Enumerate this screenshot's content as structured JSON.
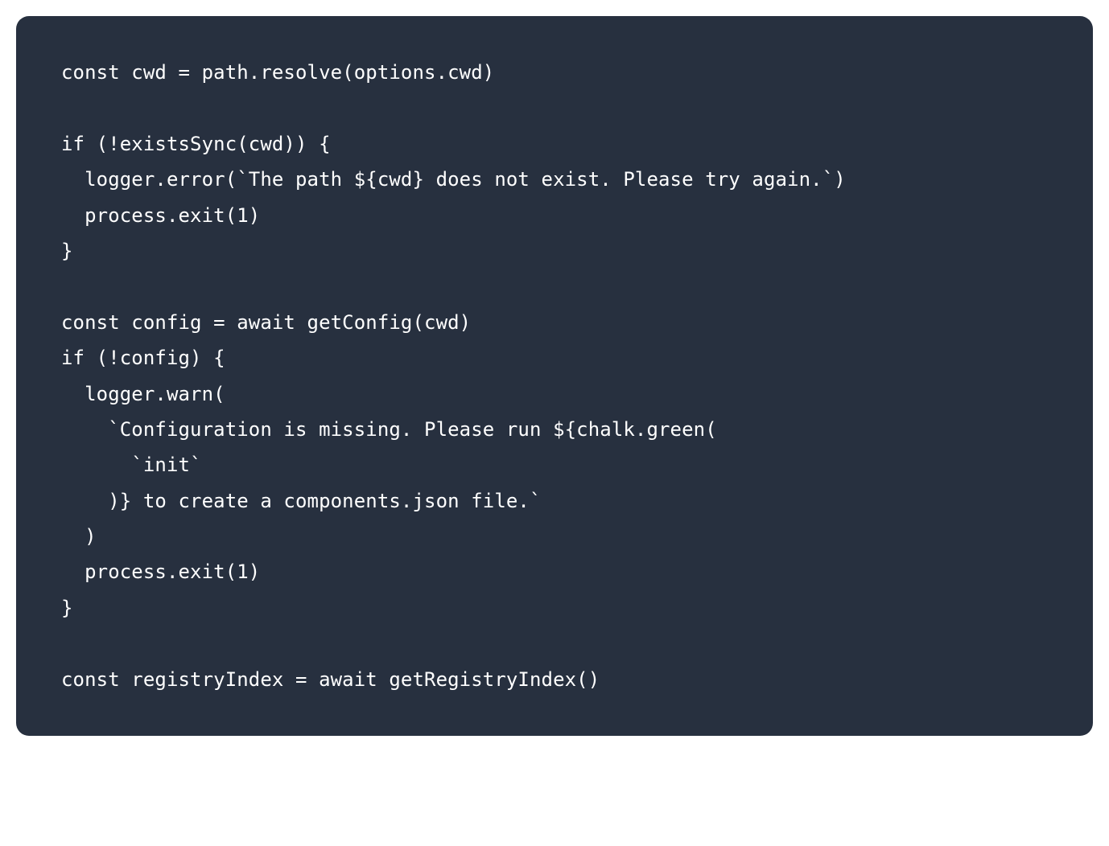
{
  "code": {
    "lines": [
      "const cwd = path.resolve(options.cwd)",
      "",
      "if (!existsSync(cwd)) {",
      "  logger.error(`The path ${cwd} does not exist. Please try again.`)",
      "  process.exit(1)",
      "}",
      "",
      "const config = await getConfig(cwd)",
      "if (!config) {",
      "  logger.warn(",
      "    `Configuration is missing. Please run ${chalk.green(",
      "      `init`",
      "    )} to create a components.json file.`",
      "  )",
      "  process.exit(1)",
      "}",
      "",
      "const registryIndex = await getRegistryIndex()"
    ]
  },
  "colors": {
    "background": "#27303f",
    "foreground": "#ffffff"
  }
}
